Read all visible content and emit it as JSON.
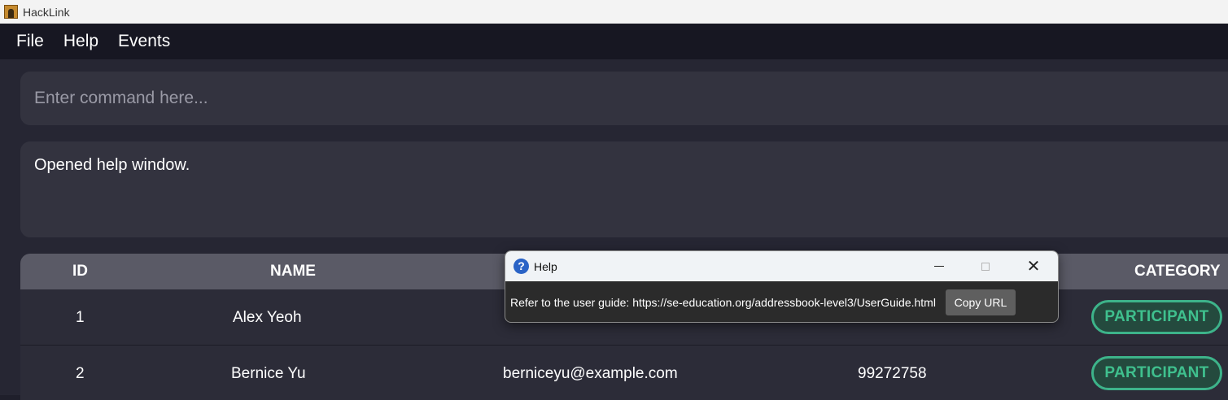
{
  "window": {
    "title": "HackLink"
  },
  "menu": [
    {
      "label": "File"
    },
    {
      "label": "Help"
    },
    {
      "label": "Events"
    }
  ],
  "command": {
    "placeholder": "Enter command here..."
  },
  "result": {
    "text": "Opened help window."
  },
  "table": {
    "headers": {
      "id": "ID",
      "name": "NAME",
      "category": "CATEGORY"
    },
    "rows": [
      {
        "id": "1",
        "name": "Alex Yeoh",
        "category": "PARTICIPANT"
      },
      {
        "id": "2",
        "name": "Bernice Yu",
        "email": "berniceyu@example.com",
        "phone": "99272758",
        "category": "PARTICIPANT"
      }
    ]
  },
  "dialog": {
    "title": "Help",
    "message": "Refer to the user guide: https://se-education.org/addressbook-level3/UserGuide.html",
    "copy_label": "Copy URL",
    "close_glyph": "✕",
    "help_glyph": "?"
  },
  "colors": {
    "accent_green": "#3db38a",
    "background": "#262633",
    "panel": "#33333f"
  }
}
